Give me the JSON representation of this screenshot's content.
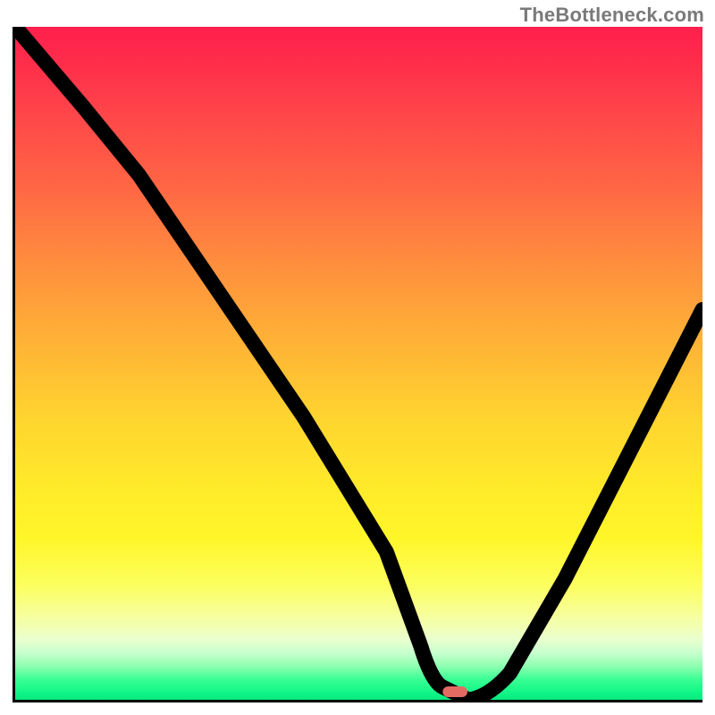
{
  "watermark": "TheBottleneck.com",
  "chart_data": {
    "type": "line",
    "title": "",
    "xlabel": "",
    "ylabel": "",
    "xlim": [
      0,
      100
    ],
    "ylim": [
      0,
      100
    ],
    "grid": false,
    "legend": false,
    "series": [
      {
        "name": "bottleneck-curve",
        "x": [
          0,
          10,
          18,
          30,
          42,
          54,
          59,
          62,
          66,
          72,
          80,
          90,
          100
        ],
        "y": [
          100,
          88,
          78,
          60,
          42,
          22,
          8,
          2,
          0,
          4,
          18,
          38,
          58
        ]
      }
    ],
    "marker": {
      "x": 64,
      "y": 0.8,
      "color": "#e26a63",
      "shape": "pill"
    },
    "background_gradient": {
      "top": "#ff1f4d",
      "mid": "#ffe92a",
      "bottom": "#09e77e"
    }
  }
}
